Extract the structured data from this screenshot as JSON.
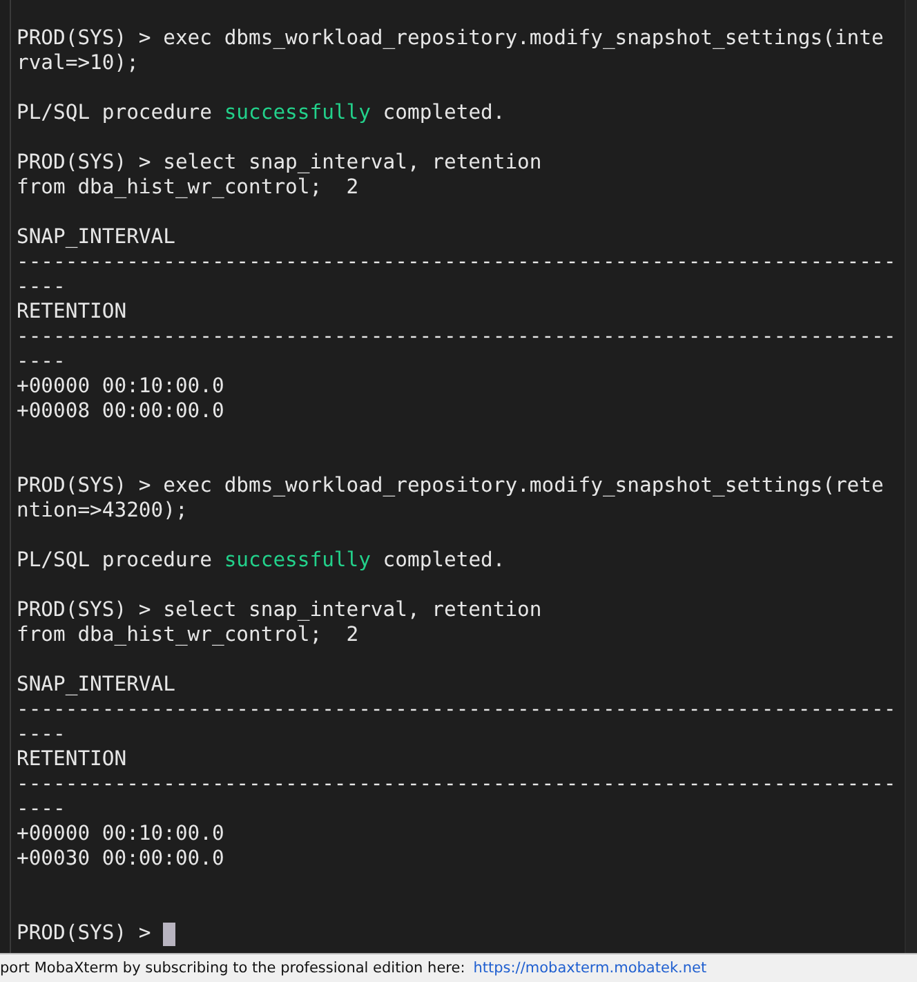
{
  "terminal": {
    "lines": [
      {
        "kind": "text",
        "segments": [
          {
            "kind": "plain",
            "text": "PROD(SYS) > exec dbms_workload_repository.modify_snapshot_settings(inte"
          }
        ]
      },
      {
        "kind": "text",
        "segments": [
          {
            "kind": "plain",
            "text": "rval=>10);"
          }
        ]
      },
      {
        "kind": "blank"
      },
      {
        "kind": "text",
        "segments": [
          {
            "kind": "plain",
            "text": "PL/SQL procedure "
          },
          {
            "kind": "success",
            "text": "successfully"
          },
          {
            "kind": "plain",
            "text": " completed."
          }
        ]
      },
      {
        "kind": "blank"
      },
      {
        "kind": "text",
        "segments": [
          {
            "kind": "plain",
            "text": "PROD(SYS) > select snap_interval, retention"
          }
        ]
      },
      {
        "kind": "text",
        "segments": [
          {
            "kind": "plain",
            "text": "from dba_hist_wr_control;  2"
          }
        ]
      },
      {
        "kind": "blank"
      },
      {
        "kind": "text",
        "segments": [
          {
            "kind": "plain",
            "text": "SNAP_INTERVAL"
          }
        ]
      },
      {
        "kind": "text",
        "segments": [
          {
            "kind": "plain",
            "text": "------------------------------------------------------------------------"
          }
        ]
      },
      {
        "kind": "text",
        "segments": [
          {
            "kind": "plain",
            "text": "----"
          }
        ]
      },
      {
        "kind": "text",
        "segments": [
          {
            "kind": "plain",
            "text": "RETENTION"
          }
        ]
      },
      {
        "kind": "text",
        "segments": [
          {
            "kind": "plain",
            "text": "------------------------------------------------------------------------"
          }
        ]
      },
      {
        "kind": "text",
        "segments": [
          {
            "kind": "plain",
            "text": "----"
          }
        ]
      },
      {
        "kind": "text",
        "segments": [
          {
            "kind": "plain",
            "text": "+00000 00:10:00.0"
          }
        ]
      },
      {
        "kind": "text",
        "segments": [
          {
            "kind": "plain",
            "text": "+00008 00:00:00.0"
          }
        ]
      },
      {
        "kind": "blank"
      },
      {
        "kind": "blank"
      },
      {
        "kind": "text",
        "segments": [
          {
            "kind": "plain",
            "text": "PROD(SYS) > exec dbms_workload_repository.modify_snapshot_settings(rete"
          }
        ]
      },
      {
        "kind": "text",
        "segments": [
          {
            "kind": "plain",
            "text": "ntion=>43200);"
          }
        ]
      },
      {
        "kind": "blank"
      },
      {
        "kind": "text",
        "segments": [
          {
            "kind": "plain",
            "text": "PL/SQL procedure "
          },
          {
            "kind": "success",
            "text": "successfully"
          },
          {
            "kind": "plain",
            "text": " completed."
          }
        ]
      },
      {
        "kind": "blank"
      },
      {
        "kind": "text",
        "segments": [
          {
            "kind": "plain",
            "text": "PROD(SYS) > select snap_interval, retention"
          }
        ]
      },
      {
        "kind": "text",
        "segments": [
          {
            "kind": "plain",
            "text": "from dba_hist_wr_control;  2"
          }
        ]
      },
      {
        "kind": "blank"
      },
      {
        "kind": "text",
        "segments": [
          {
            "kind": "plain",
            "text": "SNAP_INTERVAL"
          }
        ]
      },
      {
        "kind": "text",
        "segments": [
          {
            "kind": "plain",
            "text": "------------------------------------------------------------------------"
          }
        ]
      },
      {
        "kind": "text",
        "segments": [
          {
            "kind": "plain",
            "text": "----"
          }
        ]
      },
      {
        "kind": "text",
        "segments": [
          {
            "kind": "plain",
            "text": "RETENTION"
          }
        ]
      },
      {
        "kind": "text",
        "segments": [
          {
            "kind": "plain",
            "text": "------------------------------------------------------------------------"
          }
        ]
      },
      {
        "kind": "text",
        "segments": [
          {
            "kind": "plain",
            "text": "----"
          }
        ]
      },
      {
        "kind": "text",
        "segments": [
          {
            "kind": "plain",
            "text": "+00000 00:10:00.0"
          }
        ]
      },
      {
        "kind": "text",
        "segments": [
          {
            "kind": "plain",
            "text": "+00030 00:00:00.0"
          }
        ]
      },
      {
        "kind": "blank"
      },
      {
        "kind": "blank"
      },
      {
        "kind": "text",
        "cursor": true,
        "segments": [
          {
            "kind": "plain",
            "text": "PROD(SYS) > "
          }
        ]
      }
    ]
  },
  "status_bar": {
    "message": "port MobaXterm by subscribing to the professional edition here:",
    "link": "https://mobaxterm.mobatek.net"
  }
}
